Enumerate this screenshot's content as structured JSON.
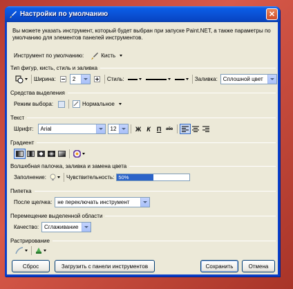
{
  "window": {
    "title": "Настройки по умолчанию",
    "close_glyph": "✕",
    "intro": "Вы можете указать инструмент, который будет выбран при запуске Paint.NET, а также параметры по умолчанию для элементов панелей инструментов."
  },
  "default_tool": {
    "label": "Инструмент по умолчанию:",
    "value": "Кисть"
  },
  "shape_section": {
    "title": "Тип фигур, кисть, стиль и заливка",
    "width_label": "Ширина:",
    "width_value": "2",
    "style_label": "Стиль:",
    "fill_label": "Заливка:",
    "fill_value": "Сплошной цвет"
  },
  "selection_section": {
    "title": "Средства выделения",
    "mode_label": "Режим выбора:",
    "mode_value": "Нормальное"
  },
  "text_section": {
    "title": "Текст",
    "font_label": "Шрифт:",
    "font_value": "Arial",
    "size_value": "12",
    "bold": "Ж",
    "italic": "К",
    "underline": "П",
    "strike": "абв"
  },
  "gradient_section": {
    "title": "Градиент"
  },
  "magic_section": {
    "title": "Волшебная палочка, заливка и замена цвета",
    "fill_label": "Заполнение:",
    "sensitivity_label": "Чувствительность:",
    "sensitivity_text": "50%",
    "sensitivity_fraction": 0.5
  },
  "picker_section": {
    "title": "Пипетка",
    "after_click_label": "После щелчка:",
    "after_click_value": "не переключать инструмент"
  },
  "move_section": {
    "title": "Перемещение выделенной области",
    "quality_label": "Качество:",
    "quality_value": "Сглаживание"
  },
  "raster_section": {
    "title": "Растрирование"
  },
  "buttons": {
    "reset": "Сброс",
    "load": "Загрузить с панели инструментов",
    "save": "Сохранить",
    "cancel": "Отмена"
  },
  "colors": {
    "titlebar": "#0a52d6",
    "dialog_bg": "#ece9d8",
    "selection_blue": "#2b63c8",
    "outer_bg": "#c24a3e"
  }
}
